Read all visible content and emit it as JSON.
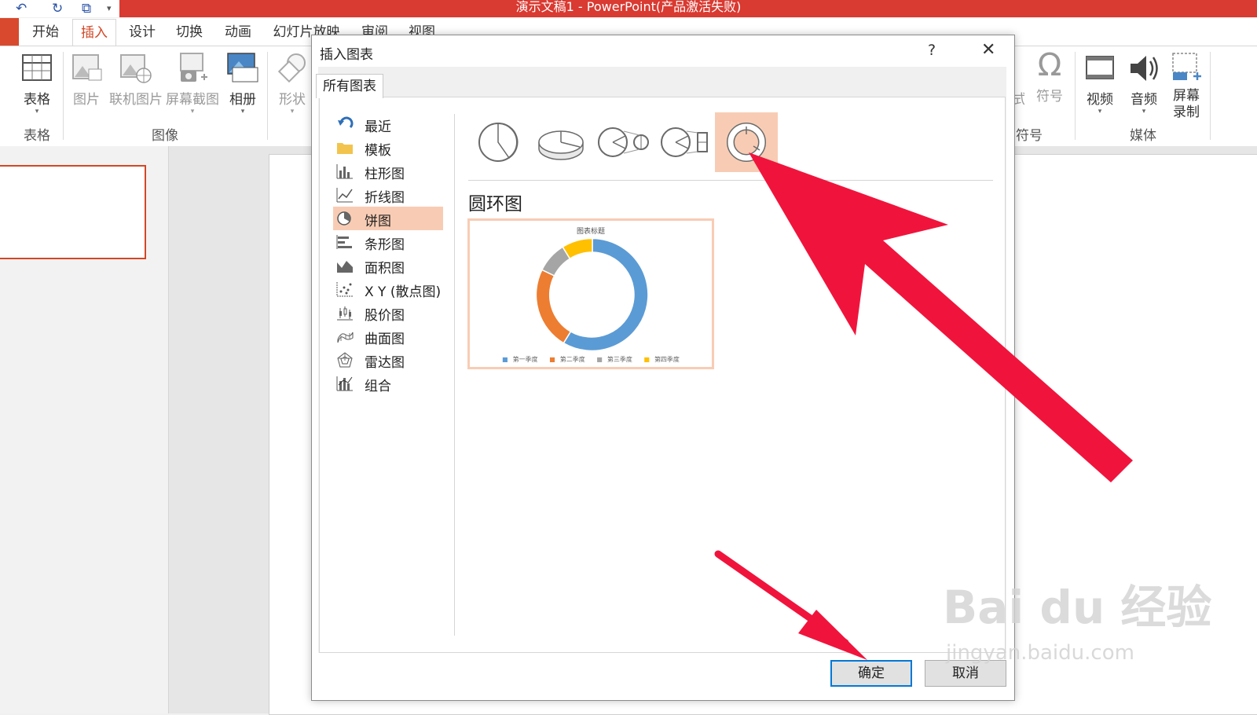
{
  "window": {
    "title": "演示文稿1 - PowerPoint(产品激活失败)"
  },
  "quick_access": {
    "icons": [
      "undo-icon",
      "redo-icon",
      "presentation-icon",
      "customize-icon"
    ]
  },
  "ribbon": {
    "tabs": [
      {
        "label": "开始"
      },
      {
        "label": "插入"
      },
      {
        "label": "设计"
      },
      {
        "label": "切换"
      },
      {
        "label": "动画"
      },
      {
        "label": "幻灯片放映"
      },
      {
        "label": "审阅"
      },
      {
        "label": "视图"
      }
    ],
    "active_tab": "插入",
    "buttons": {
      "table": "表格",
      "picture": "图片",
      "online_picture": "联机图片",
      "screenshot": "屏幕截图",
      "album": "相册",
      "shapes": "形状",
      "equation_partial": "式",
      "symbol": "符号",
      "video": "视频",
      "audio": "音频",
      "screen_record": "屏幕\n录制"
    },
    "groups": {
      "table": "表格",
      "images": "图像",
      "symbols": "符号",
      "media": "媒体"
    }
  },
  "dialog": {
    "title": "插入图表",
    "help": "?",
    "close": "✕",
    "tab": "所有图表",
    "categories": [
      {
        "label": "最近",
        "icon": "recent-icon"
      },
      {
        "label": "模板",
        "icon": "folder-icon"
      },
      {
        "label": "柱形图",
        "icon": "column-chart-icon"
      },
      {
        "label": "折线图",
        "icon": "line-chart-icon"
      },
      {
        "label": "饼图",
        "icon": "pie-chart-icon"
      },
      {
        "label": "条形图",
        "icon": "bar-chart-icon"
      },
      {
        "label": "面积图",
        "icon": "area-chart-icon"
      },
      {
        "label": "X Y (散点图)",
        "icon": "scatter-chart-icon"
      },
      {
        "label": "股价图",
        "icon": "stock-chart-icon"
      },
      {
        "label": "曲面图",
        "icon": "surface-chart-icon"
      },
      {
        "label": "雷达图",
        "icon": "radar-chart-icon"
      },
      {
        "label": "组合",
        "icon": "combo-chart-icon"
      }
    ],
    "selected_category": "饼图",
    "subtypes": [
      "pie",
      "3d-pie",
      "pie-of-pie",
      "bar-of-pie",
      "doughnut"
    ],
    "selected_subtype": "doughnut",
    "subtype_title": "圆环图",
    "preview": {
      "title": "图表标题",
      "legend": [
        "第一季度",
        "第二季度",
        "第三季度",
        "第四季度"
      ],
      "colors": [
        "#5b9bd5",
        "#ed7d31",
        "#a5a5a5",
        "#ffc000"
      ]
    },
    "ok_label": "确定",
    "cancel_label": "取消"
  },
  "watermark": {
    "brand": "Bai du 经验",
    "url": "jingyan.baidu.com"
  },
  "colors": {
    "title_bar": "#d93a31",
    "accent": "#d24726",
    "selection": "#f8ccb4",
    "annotation_arrow": "#f0143c"
  }
}
